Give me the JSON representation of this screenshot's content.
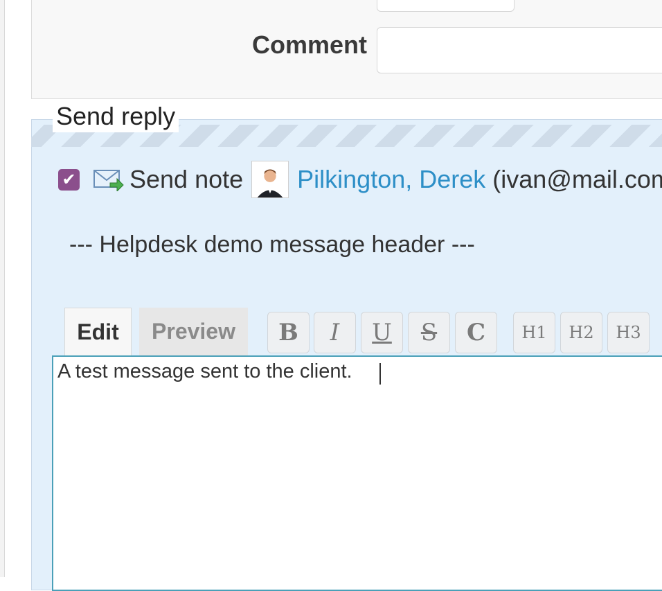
{
  "form": {
    "comment_label": "Comment",
    "comment_value": ""
  },
  "reply": {
    "legend": "Send reply",
    "checkbox_checked": true,
    "send_note_label": "Send note",
    "person_name": "Pilkington, Derek",
    "person_email": "(ivan@mail.com)",
    "message_header": "--- Helpdesk demo message header ---"
  },
  "editor": {
    "tabs": [
      {
        "label": "Edit",
        "active": true
      },
      {
        "label": "Preview",
        "active": false
      }
    ],
    "toolbar": [
      "B",
      "I",
      "U",
      "S",
      "C",
      "H1",
      "H2",
      "H3"
    ],
    "text": "A test message sent to the client."
  },
  "colors": {
    "accent": "#8b4f8c",
    "link": "#2d8fc7",
    "panel": "#e3f0fb",
    "editor_border": "#4aa0b8"
  }
}
